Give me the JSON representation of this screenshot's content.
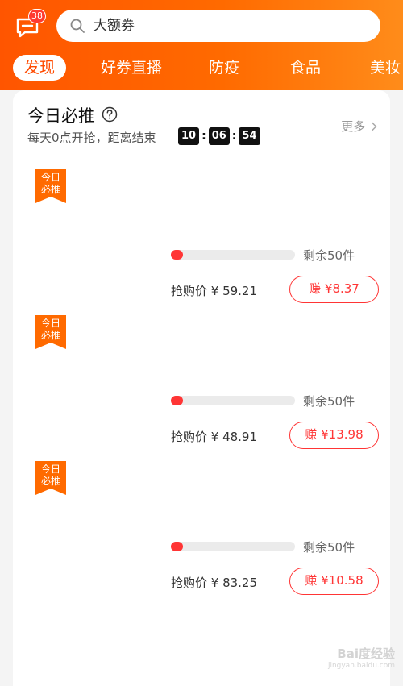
{
  "header": {
    "message_badge": "38",
    "search": {
      "placeholder": "大额券"
    },
    "tabs": [
      {
        "label": "发现",
        "active": true
      },
      {
        "label": "好券直播",
        "active": false
      },
      {
        "label": "防疫",
        "active": false
      },
      {
        "label": "食品",
        "active": false
      },
      {
        "label": "美妆",
        "active": false
      }
    ]
  },
  "section": {
    "title": "今日必推",
    "subtitle": "每天0点开抢，距离结束",
    "countdown": {
      "hours": "10",
      "minutes": "06",
      "seconds": "54"
    },
    "more_label": "更多"
  },
  "items": [
    {
      "ribbon_line1": "今日",
      "ribbon_line2": "必推",
      "progress": 0.05,
      "stock": "剩余50件",
      "price": "抢购价 ¥ 59.21",
      "earn": "赚 ¥8.37"
    },
    {
      "ribbon_line1": "今日",
      "ribbon_line2": "必推",
      "progress": 0.05,
      "stock": "剩余50件",
      "price": "抢购价 ¥ 48.91",
      "earn": "赚 ¥13.98"
    },
    {
      "ribbon_line1": "今日",
      "ribbon_line2": "必推",
      "progress": 0.05,
      "stock": "剩余50件",
      "price": "抢购价 ¥ 83.25",
      "earn": "赚 ¥10.58"
    }
  ],
  "watermark": {
    "logo": "Bai度经验",
    "url": "jingyan.baidu.com"
  },
  "colors": {
    "brand": "#ff5500",
    "accent_red": "#ff3535",
    "ribbon": "#ff6a00"
  }
}
